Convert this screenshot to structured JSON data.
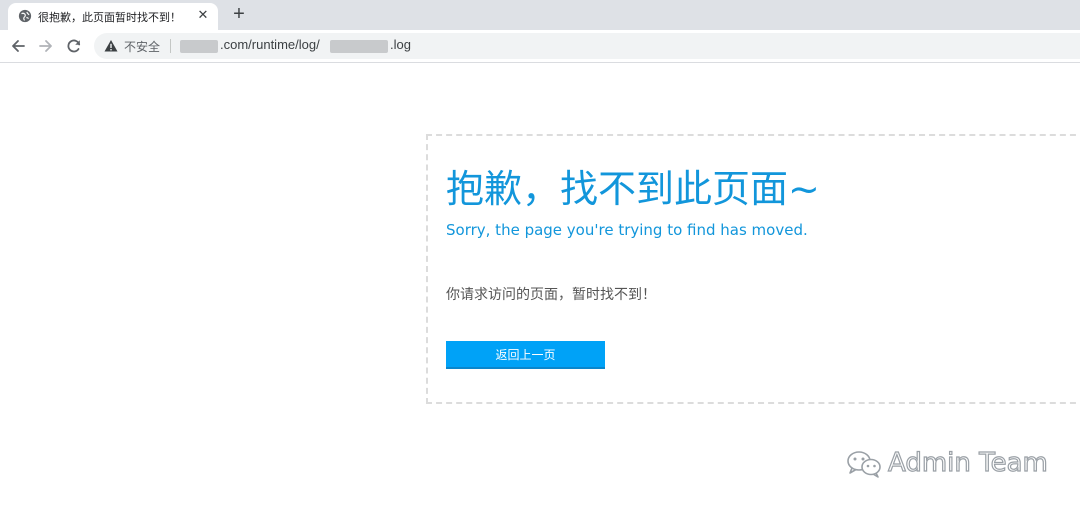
{
  "browser": {
    "tab": {
      "title": "很抱歉，此页面暂时找不到！",
      "close_label": "✕"
    },
    "new_tab_label": "+",
    "omnibox": {
      "security_label": "不安全",
      "url_domain_suffix": ".com/runtime/log/",
      "url_file_suffix": ".log"
    }
  },
  "page": {
    "title": "抱歉，找不到此页面~",
    "subtitle": "Sorry, the page you're trying to find has moved.",
    "message": "你请求访问的页面，暂时找不到！",
    "back_button_label": "返回上一页"
  },
  "watermark": {
    "text": "Admin Team"
  },
  "colors": {
    "accent": "#1296db",
    "button": "#00a2f7",
    "tabbar": "#dee1e6",
    "omnibox": "#f1f3f4"
  },
  "icons": {
    "tab_favicon": "globe-icon",
    "back": "arrow-left-icon",
    "forward": "arrow-right-icon",
    "reload": "reload-icon",
    "security": "warning-triangle-icon",
    "watermark_logo": "wechat-logo-icon"
  }
}
